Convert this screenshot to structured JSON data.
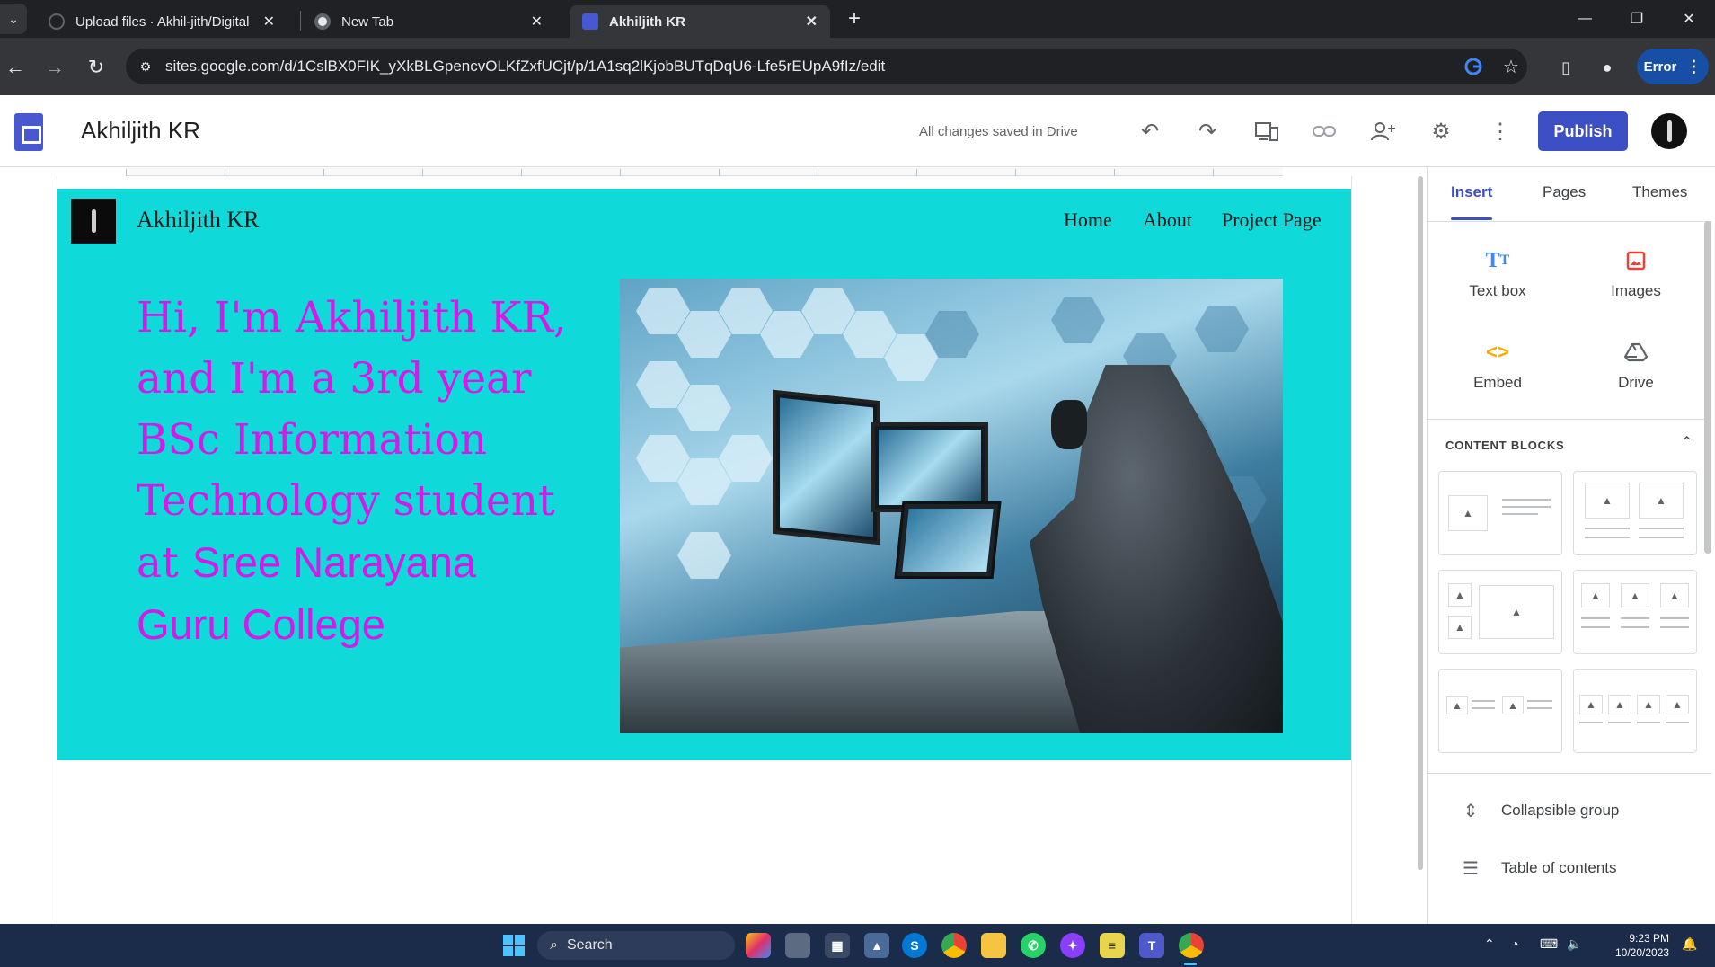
{
  "browser": {
    "tabs": [
      {
        "title": "Upload files · Akhil-jith/Digital",
        "close": "✕"
      },
      {
        "title": "New Tab",
        "close": "✕"
      },
      {
        "title": "Akhiljith KR",
        "close": "✕"
      }
    ],
    "new_tab": "+",
    "url": "sites.google.com/d/1CslBX0FIK_yXkBLGpencvOLKfZxfUCjt/p/1A1sq2lKjobBUTqDqU6-Lfe5rEUpA9fIz/edit",
    "profile_chip": "Error"
  },
  "app": {
    "site_name": "Akhiljith KR",
    "save_status": "All changes saved in Drive",
    "publish_label": "Publish",
    "accent": "#3d4fc4"
  },
  "hero": {
    "site_title": "Akhiljith KR",
    "nav": [
      "Home",
      "About",
      "Project Page"
    ],
    "heading_serif": "Hi, I'm Akhiljith KR, and I'm a 3rd year BSc Information Technology student at ",
    "heading_sans": "Sree Narayana Guru College",
    "background": "#10d9d9",
    "text_color": "#d41ae6"
  },
  "panel": {
    "tabs": [
      "Insert",
      "Pages",
      "Themes"
    ],
    "insert_items": [
      {
        "label": "Text box",
        "icon": "text-box-icon"
      },
      {
        "label": "Images",
        "icon": "image-icon"
      },
      {
        "label": "Embed",
        "icon": "embed-icon"
      },
      {
        "label": "Drive",
        "icon": "drive-icon"
      }
    ],
    "blocks_title": "CONTENT BLOCKS",
    "list_items": [
      {
        "label": "Collapsible group",
        "icon": "collapsible-group-icon"
      },
      {
        "label": "Table of contents",
        "icon": "table-of-contents-icon"
      }
    ]
  },
  "taskbar": {
    "search_label": "Search",
    "time": "9:23 PM",
    "date": "10/20/2023"
  }
}
